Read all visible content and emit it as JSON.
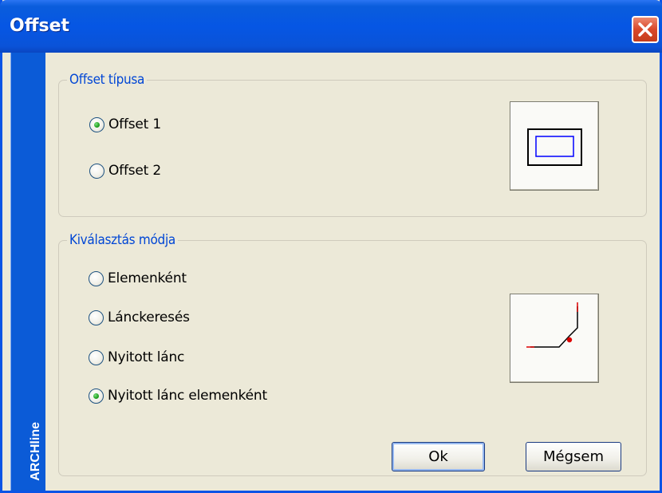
{
  "window": {
    "title": "Offset"
  },
  "side_strip": {
    "label": "ARCHline"
  },
  "offset_type": {
    "legend": "Offset típusa",
    "options": [
      {
        "label": "Offset 1",
        "checked": true
      },
      {
        "label": "Offset 2",
        "checked": false
      }
    ]
  },
  "selection_mode": {
    "legend": "Kiválasztás módja",
    "options": [
      {
        "label": "Elemenként",
        "checked": false
      },
      {
        "label": "Lánckeresés",
        "checked": false
      },
      {
        "label": "Nyitott lánc",
        "checked": false
      },
      {
        "label": "Nyitott lánc elemenként",
        "checked": true
      }
    ]
  },
  "buttons": {
    "ok": "Ok",
    "cancel": "Mégsem"
  },
  "colors": {
    "title_bar": "#0656e4",
    "legend_text": "#0046d5",
    "preview_rect": "#0000ff",
    "preview_point": "#dd0000"
  }
}
